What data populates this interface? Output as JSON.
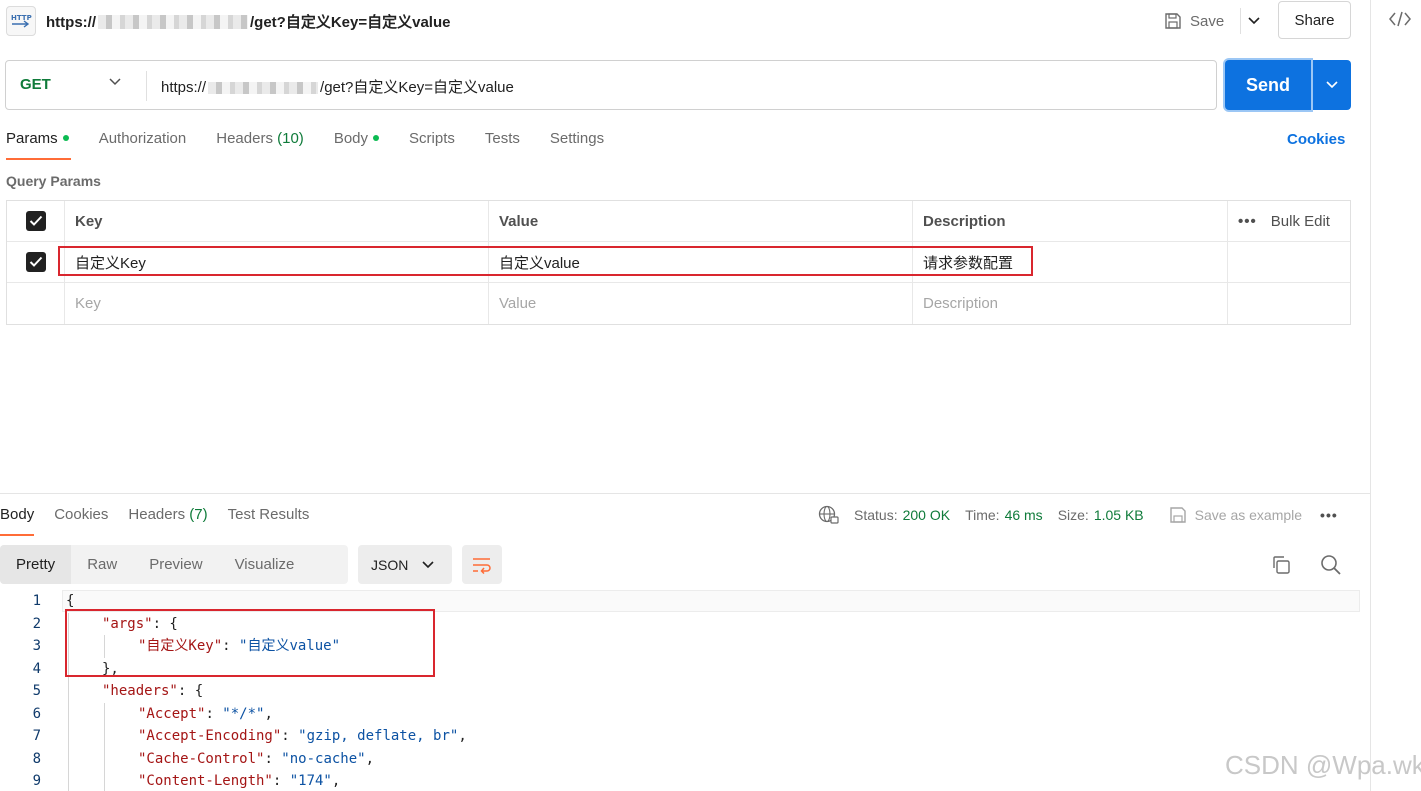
{
  "header": {
    "title_prefix": "https://",
    "title_suffix": "/get?自定义Key=自定义value",
    "save_label": "Save",
    "share_label": "Share"
  },
  "url_bar": {
    "method": "GET",
    "url_prefix": "https://",
    "url_suffix": "/get?自定义Key=自定义value",
    "send_label": "Send"
  },
  "request_tabs": [
    {
      "label": "Params",
      "active": true,
      "dot": true
    },
    {
      "label": "Authorization",
      "active": false
    },
    {
      "label": "Headers",
      "count": "(10)",
      "active": false
    },
    {
      "label": "Body",
      "active": false,
      "dot": true
    },
    {
      "label": "Scripts",
      "active": false
    },
    {
      "label": "Tests",
      "active": false
    },
    {
      "label": "Settings",
      "active": false
    }
  ],
  "cookies_label": "Cookies",
  "query_params": {
    "title": "Query Params",
    "headers": {
      "key": "Key",
      "value": "Value",
      "description": "Description",
      "bulk_edit": "Bulk Edit"
    },
    "rows": [
      {
        "checked": true,
        "key": "自定义Key",
        "value": "自定义value",
        "description": "请求参数配置"
      }
    ],
    "placeholder": {
      "key": "Key",
      "value": "Value",
      "description": "Description"
    }
  },
  "response_tabs": [
    {
      "label": "Body",
      "active": true
    },
    {
      "label": "Cookies",
      "active": false
    },
    {
      "label": "Headers",
      "count": "(7)",
      "active": false
    },
    {
      "label": "Test Results",
      "active": false
    }
  ],
  "status": {
    "status_label": "Status:",
    "status_value": "200 OK",
    "time_label": "Time:",
    "time_value": "46 ms",
    "size_label": "Size:",
    "size_value": "1.05 KB",
    "save_example": "Save as example"
  },
  "view_modes": [
    "Pretty",
    "Raw",
    "Preview",
    "Visualize"
  ],
  "format": "JSON",
  "code_lines": [
    {
      "n": "1",
      "indent": 0,
      "parts": [
        [
          "p",
          "{"
        ]
      ]
    },
    {
      "n": "2",
      "indent": 1,
      "parts": [
        [
          "k",
          "\"args\""
        ],
        [
          "p",
          ": {"
        ]
      ]
    },
    {
      "n": "3",
      "indent": 2,
      "parts": [
        [
          "k",
          "\"自定义Key\""
        ],
        [
          "p",
          ": "
        ],
        [
          "s",
          "\"自定义value\""
        ]
      ]
    },
    {
      "n": "4",
      "indent": 1,
      "parts": [
        [
          "p",
          "},"
        ]
      ]
    },
    {
      "n": "5",
      "indent": 1,
      "parts": [
        [
          "k",
          "\"headers\""
        ],
        [
          "p",
          ": {"
        ]
      ]
    },
    {
      "n": "6",
      "indent": 2,
      "parts": [
        [
          "k",
          "\"Accept\""
        ],
        [
          "p",
          ": "
        ],
        [
          "s",
          "\"*/*\""
        ],
        [
          "p",
          ","
        ]
      ]
    },
    {
      "n": "7",
      "indent": 2,
      "parts": [
        [
          "k",
          "\"Accept-Encoding\""
        ],
        [
          "p",
          ": "
        ],
        [
          "s",
          "\"gzip, deflate, br\""
        ],
        [
          "p",
          ","
        ]
      ]
    },
    {
      "n": "8",
      "indent": 2,
      "parts": [
        [
          "k",
          "\"Cache-Control\""
        ],
        [
          "p",
          ": "
        ],
        [
          "s",
          "\"no-cache\""
        ],
        [
          "p",
          ","
        ]
      ]
    },
    {
      "n": "9",
      "indent": 2,
      "parts": [
        [
          "k",
          "\"Content-Length\""
        ],
        [
          "p",
          ": "
        ],
        [
          "s",
          "\"174\""
        ],
        [
          "p",
          ","
        ]
      ]
    }
  ],
  "watermark": "CSDN @Wpa.wk"
}
